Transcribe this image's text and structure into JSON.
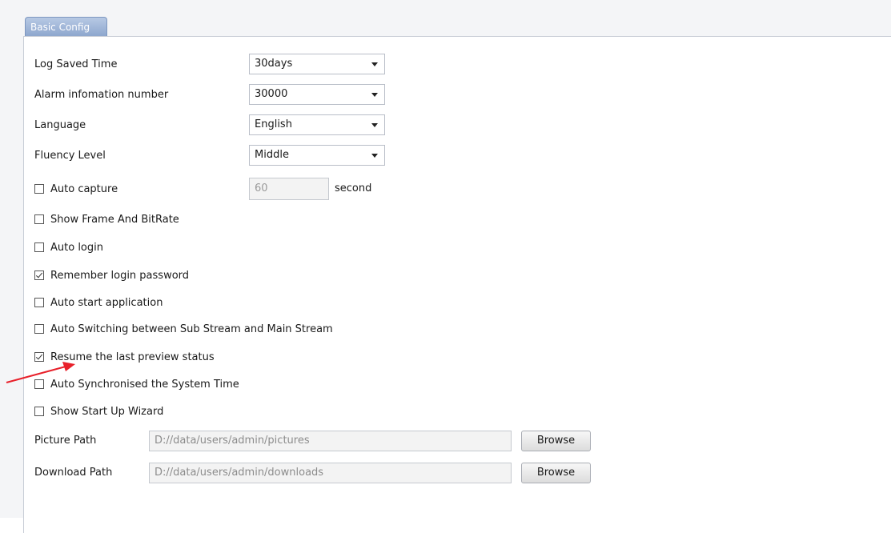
{
  "tab": {
    "label": "Basic Config"
  },
  "settings": {
    "log_saved_time": {
      "label": "Log Saved Time",
      "value": "30days"
    },
    "alarm_number": {
      "label": "Alarm infomation number",
      "value": "30000"
    },
    "language": {
      "label": "Language",
      "value": "English"
    },
    "fluency_level": {
      "label": "Fluency Level",
      "value": "Middle"
    }
  },
  "auto_capture": {
    "label": "Auto capture",
    "value": "60",
    "unit": "second",
    "checked": false
  },
  "checkboxes": [
    {
      "label": "Show Frame And BitRate",
      "checked": false
    },
    {
      "label": "Auto login",
      "checked": false
    },
    {
      "label": "Remember login password",
      "checked": true
    },
    {
      "label": "Auto start application",
      "checked": false
    },
    {
      "label": "Auto Switching between Sub Stream and Main Stream",
      "checked": false
    },
    {
      "label": "Resume the last preview status",
      "checked": true
    },
    {
      "label": "Auto Synchronised the System Time",
      "checked": false
    },
    {
      "label": "Show Start Up Wizard",
      "checked": false
    }
  ],
  "paths": {
    "picture": {
      "label": "Picture Path",
      "value": "D://data/users/admin/pictures",
      "button": "Browse"
    },
    "download": {
      "label": "Download Path",
      "value": "D://data/users/admin/downloads",
      "button": "Browse"
    }
  },
  "colors": {
    "tab": "#8ea7ce",
    "annotation_arrow": "#e8202a"
  }
}
